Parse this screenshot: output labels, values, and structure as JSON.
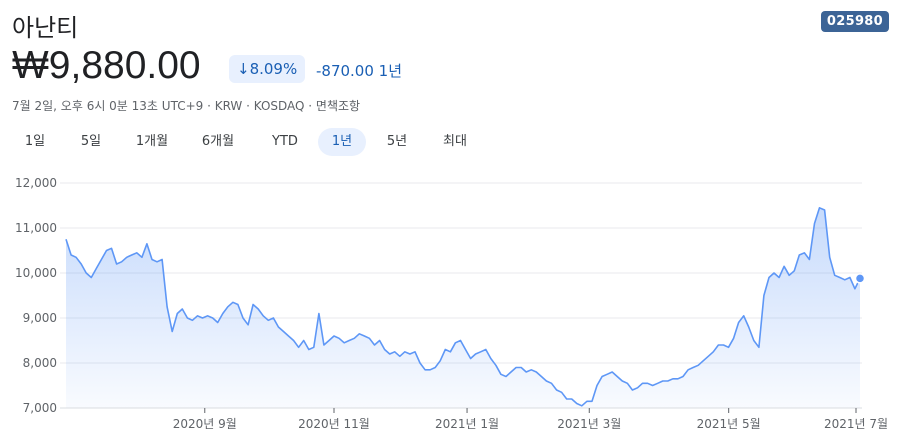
{
  "header": {
    "title": "아난티",
    "ticker": "025980",
    "price": "₩9,880.00",
    "change_pct": "↓8.09%",
    "change_abs": "-870.00 1년",
    "meta": "7월 2일, 오후 6시 0분 13초 UTC+9 · KRW · KOSDAQ · 면책조항"
  },
  "tabs": [
    {
      "label": "1일"
    },
    {
      "label": "5일"
    },
    {
      "label": "1개월"
    },
    {
      "label": "6개월"
    },
    {
      "label": "YTD"
    },
    {
      "label": "1년",
      "active": true
    },
    {
      "label": "5년"
    },
    {
      "label": "최대"
    }
  ],
  "colors": {
    "line": "#5e97f6",
    "accent": "#1a5fb4",
    "badge": "#3c6496"
  },
  "chart_data": {
    "type": "area",
    "ylim": [
      7000,
      12000
    ],
    "yticks": [
      12000,
      11000,
      10000,
      9000,
      8000,
      7000
    ],
    "ytick_labels": [
      "12,000",
      "11,000",
      "10,000",
      "9,000",
      "8,000",
      "7,000"
    ],
    "x_labels": [
      {
        "t": 0.218,
        "label": "2020년 9월"
      },
      {
        "t": 0.421,
        "label": "2020년 11월"
      },
      {
        "t": 0.63,
        "label": "2021년 1월"
      },
      {
        "t": 0.822,
        "label": "2021년 3월"
      },
      {
        "t": 1.041,
        "label": "2021년 5월"
      },
      {
        "t": 1.241,
        "label": "2021년 7월"
      }
    ],
    "series": [
      {
        "values": [
          10750,
          10400,
          10350,
          10200,
          10000,
          9900,
          10100,
          10300,
          10500,
          10550,
          10200,
          10250,
          10350,
          10400,
          10450,
          10350,
          10650,
          10300,
          10250,
          10300,
          9250,
          8700,
          9100,
          9200,
          9000,
          8950,
          9050,
          9000,
          9050,
          9000,
          8900,
          9100,
          9250,
          9350,
          9300,
          9000,
          8850,
          9300,
          9200,
          9050,
          8950,
          9000,
          8800,
          8700,
          8600,
          8500,
          8350,
          8500,
          8300,
          8350,
          9100,
          8400,
          8500,
          8600,
          8550,
          8450,
          8500,
          8550,
          8650,
          8600,
          8550,
          8400,
          8500,
          8300,
          8200,
          8250,
          8150,
          8250,
          8200,
          8250,
          8000,
          7850,
          7850,
          7900,
          8050,
          8300,
          8250,
          8450,
          8500,
          8300,
          8100,
          8200,
          8250,
          8300,
          8100,
          7950,
          7750,
          7700,
          7800,
          7900,
          7900,
          7800,
          7850,
          7800,
          7700,
          7600,
          7550,
          7400,
          7350,
          7200,
          7200,
          7100,
          7050,
          7150,
          7150,
          7500,
          7700,
          7750,
          7800,
          7700,
          7600,
          7550,
          7400,
          7450,
          7550,
          7550,
          7500,
          7550,
          7600,
          7600,
          7650,
          7650,
          7700,
          7850,
          7900,
          7950,
          8050,
          8150,
          8250,
          8400,
          8400,
          8350,
          8550,
          8900,
          9050,
          8800,
          8500,
          8350,
          9500,
          9900,
          10000,
          9900,
          10150,
          9950,
          10050,
          10400,
          10450,
          10300,
          11100,
          11450,
          11400,
          10350,
          9950,
          9900,
          9850,
          9900,
          9650,
          9880
        ]
      }
    ]
  }
}
